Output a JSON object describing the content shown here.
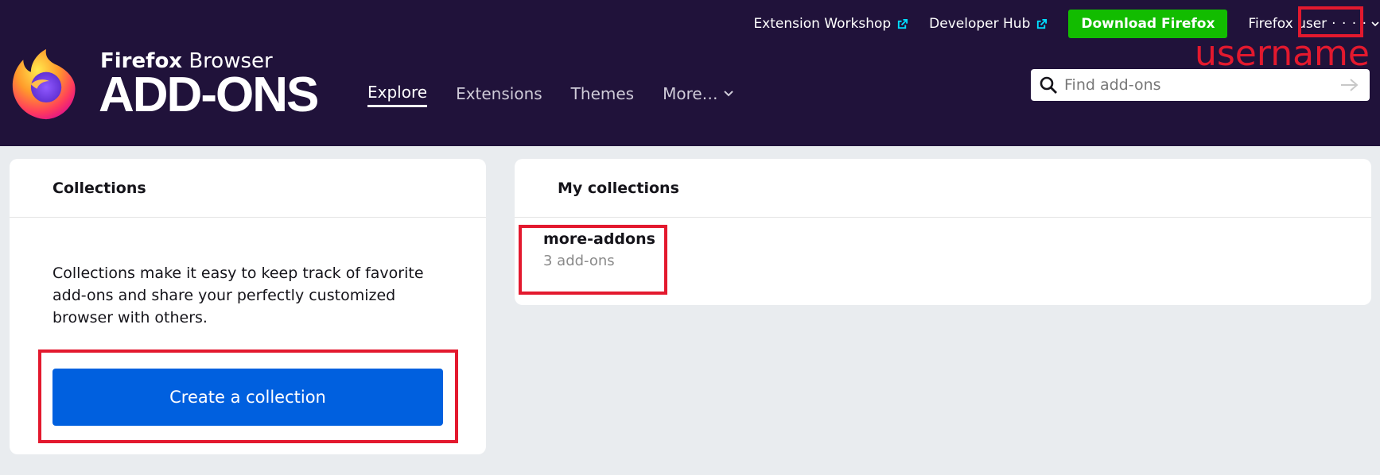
{
  "header": {
    "top_links": {
      "extension_workshop": "Extension Workshop",
      "developer_hub": "Developer Hub",
      "download": "Download Firefox",
      "user_label": "Firefox user",
      "user_name": "· · · ·"
    },
    "brand": {
      "small_bold": "Firefox",
      "small_rest": " Browser",
      "big": "ADD-ONS"
    },
    "nav": {
      "explore": "Explore",
      "extensions": "Extensions",
      "themes": "Themes",
      "more": "More…"
    },
    "search": {
      "placeholder": "Find add-ons"
    }
  },
  "annotation": {
    "label": "username",
    "color": "#e3192e"
  },
  "collections_card": {
    "title": "Collections",
    "description": "Collections make it easy to keep track of favorite add-ons and share your perfectly customized browser with others.",
    "create_button": "Create a collection"
  },
  "my_collections_card": {
    "title": "My collections",
    "items": [
      {
        "name": "more-addons",
        "count": "3 add-ons"
      }
    ]
  },
  "colors": {
    "header_bg": "#20123a",
    "download_green": "#12bc00",
    "primary_blue": "#0060df",
    "page_bg": "#e9ecef"
  }
}
